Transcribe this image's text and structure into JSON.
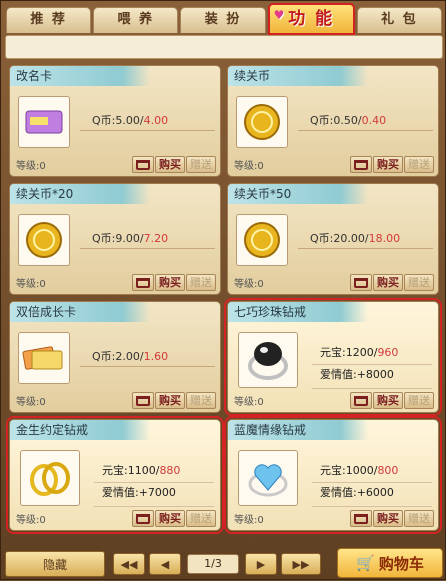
{
  "tabs": [
    {
      "label": "推 荐"
    },
    {
      "label": "喂 养"
    },
    {
      "label": "装 扮"
    },
    {
      "label": "功 能"
    },
    {
      "label": "礼 包"
    }
  ],
  "level_label": "等级:0",
  "buttons": {
    "gift_label": "赠送",
    "buy_label": "购买"
  },
  "items": [
    {
      "name": "改名卡",
      "price_prefix": "Q币:",
      "price_original": "5.00",
      "price_sep": "/",
      "price_sale": "4.00",
      "thumb_icon": "rename-card-icon"
    },
    {
      "name": "续关币",
      "price_prefix": "Q币:",
      "price_original": "0.50",
      "price_sep": "/",
      "price_sale": "0.40",
      "thumb_icon": "coin-icon"
    },
    {
      "name": "续关币*20",
      "price_prefix": "Q币:",
      "price_original": "9.00",
      "price_sep": "/",
      "price_sale": "7.20",
      "thumb_icon": "coin-icon"
    },
    {
      "name": "续关币*50",
      "price_prefix": "Q币:",
      "price_original": "20.00",
      "price_sep": "/",
      "price_sale": "18.00",
      "thumb_icon": "coin-icon"
    },
    {
      "name": "双倍成长卡",
      "price_prefix": "Q币:",
      "price_original": "2.00",
      "price_sep": "/",
      "price_sale": "1.60",
      "thumb_icon": "growth-card-icon"
    }
  ],
  "featured": [
    {
      "name": "七巧珍珠钻戒",
      "yuanbao_prefix": "元宝:",
      "yuanbao_original": "1200",
      "yuanbao_sep": "/",
      "yuanbao_sale": "960",
      "love_label": "爱情值:",
      "love_value": "+8000",
      "thumb_icon": "pearl-ring-icon"
    },
    {
      "name": "金生约定钻戒",
      "yuanbao_prefix": "元宝:",
      "yuanbao_original": "1100",
      "yuanbao_sep": "/",
      "yuanbao_sale": "880",
      "love_label": "爱情值:",
      "love_value": "+7000",
      "thumb_icon": "gold-ring-icon"
    },
    {
      "name": "蓝魔情缘钻戒",
      "yuanbao_prefix": "元宝:",
      "yuanbao_original": "1000",
      "yuanbao_sep": "/",
      "yuanbao_sale": "800",
      "love_label": "爱情值:",
      "love_value": "+6000",
      "thumb_icon": "blue-heart-ring-icon"
    }
  ],
  "pagination": {
    "current": "1/3"
  },
  "bottom": {
    "left_label": "隐藏",
    "cart_label": "购物车"
  },
  "colors": {
    "highlight": "#d42323",
    "sale_price": "#d23b3b",
    "active_tab": "#f0b43a"
  }
}
